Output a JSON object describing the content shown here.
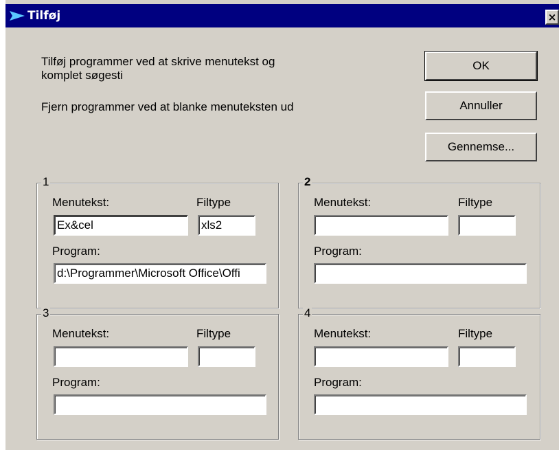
{
  "window": {
    "title": "Tilføj",
    "close_glyph": "×"
  },
  "instructions": {
    "line1": "Tilføj programmer ved at skrive menutekst og",
    "line2": "komplet søgesti",
    "line3": "Fjern programmer ved at blanke menuteksten ud"
  },
  "buttons": {
    "ok": "OK",
    "cancel": "Annuller",
    "browse": "Gennemse..."
  },
  "groups": [
    {
      "number": "1",
      "menutext_label": "Menutekst:",
      "filetype_label": "Filtype",
      "program_label": "Program:",
      "menutext": "Ex&cel",
      "filetype": "xls2",
      "program": "d:\\Programmer\\Microsoft Office\\Offi"
    },
    {
      "number": "2",
      "menutext_label": "Menutekst:",
      "filetype_label": "Filtype",
      "program_label": "Program:",
      "menutext": "",
      "filetype": "",
      "program": ""
    },
    {
      "number": "3",
      "menutext_label": "Menutekst:",
      "filetype_label": "Filtype",
      "program_label": "Program:",
      "menutext": "",
      "filetype": "",
      "program": ""
    },
    {
      "number": "4",
      "menutext_label": "Menutekst:",
      "filetype_label": "Filtype",
      "program_label": "Program:",
      "menutext": "",
      "filetype": "",
      "program": ""
    }
  ],
  "colors": {
    "titlebar": "#000080",
    "dialog_bg": "#d4d0c8"
  }
}
